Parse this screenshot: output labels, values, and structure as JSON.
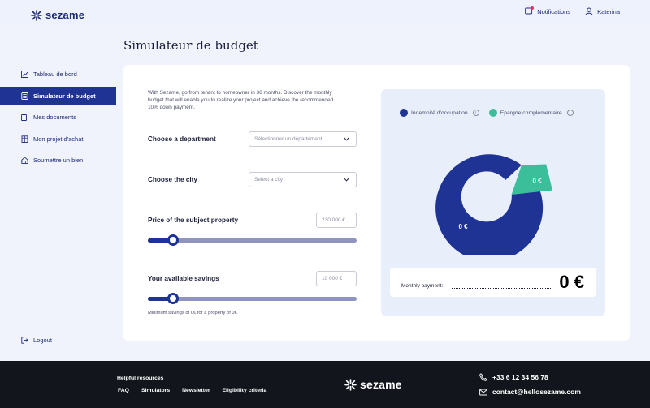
{
  "brand": {
    "name": "sezame"
  },
  "topbar": {
    "notifications": "Notifications",
    "user": "Katerina"
  },
  "sidebar": {
    "items": [
      {
        "label": "Tableau de bord",
        "icon": "chart-icon",
        "active": false
      },
      {
        "label": "Simulateur de budget",
        "icon": "calculator-icon",
        "active": true
      },
      {
        "label": "Mes documents",
        "icon": "documents-icon",
        "active": false
      },
      {
        "label": "Mon projet d'achat",
        "icon": "building-icon",
        "active": false
      },
      {
        "label": "Soumettre un bien",
        "icon": "home-icon",
        "active": false
      }
    ],
    "logout": "Logout"
  },
  "page": {
    "title": "Simulateur de budget"
  },
  "simulator": {
    "intro": "With Sezame, go from tenant to homeowner in 36 months. Discover the monthly budget that will enable you to realize your project and achieve the recommended 10% down payment.",
    "department": {
      "label": "Choose a department",
      "placeholder": "Sélectionner un département"
    },
    "city": {
      "label": "Choose the city",
      "placeholder": "Select a city"
    },
    "price": {
      "label": "Price of the subject property",
      "value": "230 000 €",
      "slider_fraction": 0.12
    },
    "savings": {
      "label": "Your available savings",
      "value": "10 000 €",
      "slider_fraction": 0.12
    },
    "hint": "Minimum savings of 0€ for a property of 0€"
  },
  "chart": {
    "legend": [
      {
        "label": "Indemnité d'occupation",
        "color": "#1e3393"
      },
      {
        "label": "Epargne complémentaire",
        "color": "#3bbf9a"
      }
    ],
    "payment_label": "Monthly payment:",
    "payment_value": "0 €"
  },
  "chart_data": {
    "type": "pie",
    "style": "donut",
    "categories": [
      "Indemnité d'occupation",
      "Epargne complémentaire"
    ],
    "values": [
      0,
      0
    ],
    "slice_labels": [
      "0 €",
      "0 €"
    ],
    "colors": [
      "#1e3393",
      "#3bbf9a"
    ]
  },
  "footer": {
    "resources_title": "Helpful resources",
    "links": [
      "FAQ",
      "Simulators",
      "Newsletter",
      "Eligibility criteria"
    ],
    "phone": "+33 6 12 34 56 78",
    "email": "contact@hellosezame.com"
  }
}
